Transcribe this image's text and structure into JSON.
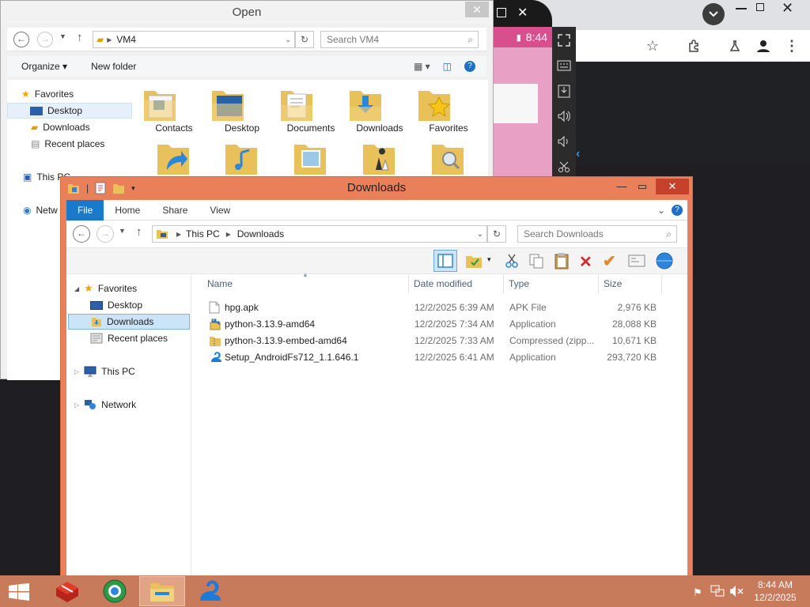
{
  "emulator": {
    "time": "8:44"
  },
  "open_dialog": {
    "title": "Open",
    "address": "VM4",
    "search_placeholder": "Search VM4",
    "organize": "Organize",
    "new_folder": "New folder",
    "tree": [
      "Favorites",
      "Desktop",
      "Downloads",
      "Recent places",
      "This PC",
      "Network"
    ],
    "tree_partial": [
      "This PC",
      "Netw"
    ],
    "folders": [
      "Contacts",
      "Desktop",
      "Documents",
      "Downloads",
      "Favorites"
    ]
  },
  "explorer": {
    "title": "Downloads",
    "tabs": {
      "file": "File",
      "home": "Home",
      "share": "Share",
      "view": "View"
    },
    "breadcrumb": [
      "This PC",
      "Downloads"
    ],
    "search_placeholder": "Search Downloads",
    "tree": {
      "favorites": "Favorites",
      "desktop": "Desktop",
      "downloads": "Downloads",
      "recent": "Recent places",
      "this_pc": "This PC",
      "network": "Network"
    },
    "columns": {
      "name": "Name",
      "date": "Date modified",
      "type": "Type",
      "size": "Size"
    },
    "files": [
      {
        "name": "hpg.apk",
        "date": "12/2/2025 6:39 AM",
        "type": "APK File",
        "size": "2,976 KB"
      },
      {
        "name": "python-3.13.9-amd64",
        "date": "12/2/2025 7:34 AM",
        "type": "Application",
        "size": "28,088 KB"
      },
      {
        "name": "python-3.13.9-embed-amd64",
        "date": "12/2/2025 7:33 AM",
        "type": "Compressed (zipp...",
        "size": "10,671 KB"
      },
      {
        "name": "Setup_AndroidFs712_1.1.646.1",
        "date": "12/2/2025 6:41 AM",
        "type": "Application",
        "size": "293,720 KB"
      }
    ]
  },
  "taskbar": {
    "time": "8:44 AM",
    "date": "12/2/2025"
  }
}
